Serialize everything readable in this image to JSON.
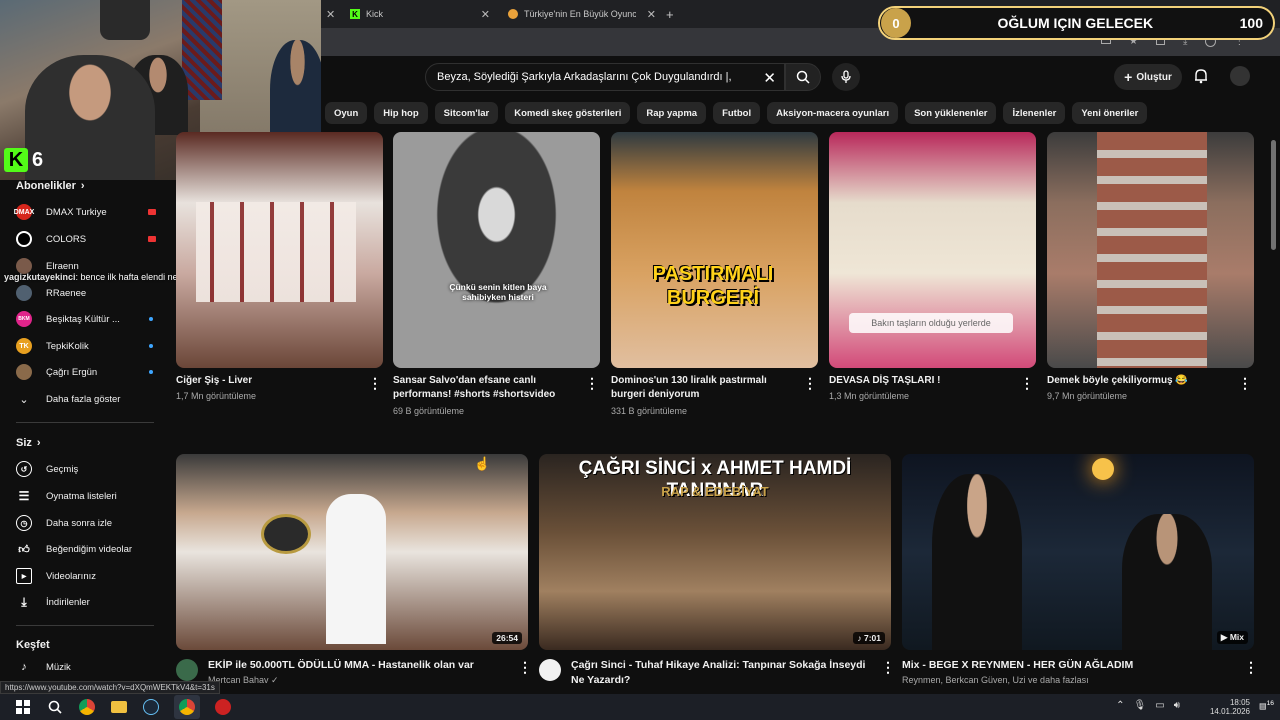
{
  "browser": {
    "tabs": [
      {
        "label": "Kick",
        "icon": "kick-icon"
      },
      {
        "label": "Türkiye'nin En Büyük Oyuncu D",
        "icon": "site-icon"
      }
    ],
    "new_tab": "+"
  },
  "overlay": {
    "kick_letter": "K",
    "viewers": "6",
    "goal": {
      "start": "0",
      "label": "OĞLUM IÇIN GELECEK",
      "end": "100"
    },
    "chat_user": "yagizkutayekinci",
    "chat_message": ": bence ilk hafta elendi net"
  },
  "masthead": {
    "search_value": "Beyza, Söylediği Şarkıyla Arkadaşlarını Çok Duygulandırdı |,",
    "create_label": "Oluştur"
  },
  "chips": [
    "Oyun",
    "Hip hop",
    "Sitcom'lar",
    "Komedi skeç gösterileri",
    "Rap yapma",
    "Futbol",
    "Aksiyon-macera oyunları",
    "Son yüklenenler",
    "İzlenenler",
    "Yeni öneriler"
  ],
  "sidebar": {
    "subs_header": "Abonelikler",
    "subs": [
      {
        "label": "DMAX Turkiye",
        "badge": "DMAX",
        "color": "#d6261c",
        "status": "live"
      },
      {
        "label": "COLORS",
        "badge": "",
        "color": "#ffffff",
        "status": "live"
      },
      {
        "label": "Elraenn",
        "badge": "",
        "color": "#7a5a4a",
        "status": "none"
      },
      {
        "label": "RRaenee",
        "badge": "",
        "color": "#506070",
        "status": "none"
      },
      {
        "label": "Beşiktaş Kültür ...",
        "badge": "BKM",
        "color": "#e0248a",
        "status": "new"
      },
      {
        "label": "TepkiKolik",
        "badge": "TK",
        "color": "#e8a020",
        "status": "new"
      },
      {
        "label": "Çağrı Ergün",
        "badge": "",
        "color": "#8a6a4a",
        "status": "new"
      }
    ],
    "more_label": "Daha fazla göster",
    "you_header": "Siz",
    "you_items": [
      {
        "label": "Geçmiş",
        "icon": "history-icon"
      },
      {
        "label": "Oynatma listeleri",
        "icon": "playlist-icon"
      },
      {
        "label": "Daha sonra izle",
        "icon": "clock-icon"
      },
      {
        "label": "Beğendiğim videolar",
        "icon": "thumbs-up-icon"
      },
      {
        "label": "Videolarınız",
        "icon": "video-icon"
      },
      {
        "label": "İndirilenler",
        "icon": "download-icon"
      }
    ],
    "explore_header": "Keşfet",
    "explore_items": [
      {
        "label": "Müzik",
        "icon": "music-icon"
      }
    ]
  },
  "shorts": [
    {
      "title": "Ciğer Şiş - Liver",
      "meta": "1,7 Mn görüntüleme",
      "overlay": ""
    },
    {
      "title": "Sansar Salvo'dan efsane canlı performans! #shorts #shortsvideo",
      "meta": "69 B görüntüleme",
      "overlay": "Çünkü senin kitlen baya sahibiyken histeri"
    },
    {
      "title": "Dominos'un 130 liralık pastırmalı burgeri deniyorum",
      "meta": "331 B görüntüleme",
      "overlay": "PASTIRMALI BURGERİ"
    },
    {
      "title": "DEVASA DİŞ TAŞLARI !",
      "meta": "1,3 Mn görüntüleme",
      "overlay": "Bakın taşların olduğu yerlerde"
    },
    {
      "title": "Demek böyle çekiliyormuş 😂",
      "meta": "9,7 Mn görüntüleme",
      "overlay": ""
    }
  ],
  "videos": [
    {
      "title": "EKİP ile 50.000TL ÖDÜLLÜ MMA - Hastanelik olan var",
      "channel": "Mertcan Bahav",
      "duration": "26:54",
      "overlay": ""
    },
    {
      "title": "Çağrı Sinci - Tuhaf Hikaye Analizi: Tanpınar Sokağa İnseydi Ne Yazardı?",
      "channel": "",
      "duration": "7:01",
      "overlay": "ÇAĞRI SİNCİ x AHMET HAMDİ TANPINAR",
      "overlay2": "RAP & EDEBİYAT"
    },
    {
      "title": "Mix - BEGE X REYNMEN - HER GÜN AĞLADIM",
      "channel": "Reynmen, Berkcan Güven, Uzi ve daha fazlası",
      "duration": "Mix",
      "overlay": ""
    }
  ],
  "status_url": "https://www.youtube.com/watch?v=dXQmWEKTkV4&t=31s",
  "taskbar": {
    "time": "18:05",
    "date": "14.01.2026",
    "notif_count": "16"
  }
}
